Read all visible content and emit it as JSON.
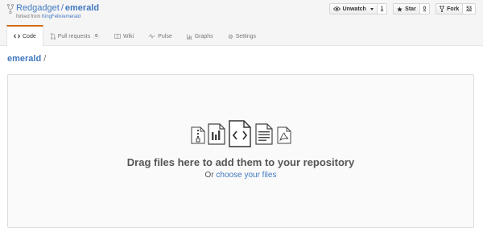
{
  "repo": {
    "owner": "Redgadget",
    "separator": "/",
    "name": "emerald",
    "forked_prefix": "forked from ",
    "forked_source": "KingFelix/emerald"
  },
  "actions": {
    "watch": {
      "label": "Unwatch",
      "count": "1"
    },
    "star": {
      "label": "Star",
      "count": "0"
    },
    "fork": {
      "label": "Fork",
      "count": "53"
    }
  },
  "tabs": [
    {
      "label": "Code",
      "icon": "code-icon",
      "selected": true
    },
    {
      "label": "Pull requests",
      "icon": "pull-request-icon",
      "counter": "0"
    },
    {
      "label": "Wiki",
      "icon": "book-icon"
    },
    {
      "label": "Pulse",
      "icon": "pulse-icon"
    },
    {
      "label": "Graphs",
      "icon": "graph-icon"
    },
    {
      "label": "Settings",
      "icon": "gear-icon"
    }
  ],
  "breadcrumb": {
    "repo": "emerald",
    "separator": "/"
  },
  "upload": {
    "title": "Drag files here to add them to your repository",
    "or": "Or ",
    "choose": "choose your files",
    "icons": [
      "zip-file-icon",
      "chart-file-icon",
      "code-file-icon",
      "text-file-icon",
      "pdf-file-icon"
    ]
  },
  "colors": {
    "link": "#4078c0",
    "tab_accent": "#d26911",
    "muted": "#767676"
  }
}
